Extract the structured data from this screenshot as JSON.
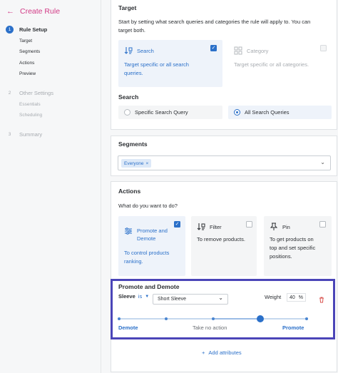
{
  "sidebar": {
    "back_title": "Create Rule",
    "steps": [
      {
        "num": "1",
        "label": "Rule Setup",
        "subs": [
          "Target",
          "Segments",
          "Actions",
          "Preview"
        ]
      },
      {
        "num": "2",
        "label": "Other Settings",
        "subs": [
          "Essentials",
          "Scheduling"
        ]
      },
      {
        "num": "3",
        "label": "Summary",
        "subs": []
      }
    ]
  },
  "target": {
    "title": "Target",
    "description_line1": "Start by setting what search queries and categories the rule will apply to. You can",
    "description_line2": "target both.",
    "options": [
      {
        "label": "Search",
        "desc_line1": "Target specific or all search",
        "desc_line2": "queries.",
        "checked": true,
        "icon": "search-sort-icon"
      },
      {
        "label": "Category",
        "desc_line1": "Target specific or all categories.",
        "desc_line2": "",
        "checked": false,
        "icon": "category-grid-icon"
      }
    ]
  },
  "search": {
    "title": "Search",
    "options": [
      {
        "label": "Specific Search Query",
        "selected": false
      },
      {
        "label": "All Search Queries",
        "selected": true
      }
    ]
  },
  "segments": {
    "title": "Segments",
    "chips": [
      "Everyone"
    ],
    "chip_remove": "×"
  },
  "actions": {
    "title": "Actions",
    "question": "What do you want to do?",
    "options": [
      {
        "label_line1": "Promote and",
        "label_line2": "Demote",
        "desc_line1": "To control products",
        "desc_line2": "ranking.",
        "desc_line3": "",
        "checked": true,
        "icon": "sliders-icon"
      },
      {
        "label_line1": "Filter",
        "label_line2": "",
        "desc_line1": "To remove products.",
        "desc_line2": "",
        "desc_line3": "",
        "checked": false,
        "icon": "filter-sort-icon"
      },
      {
        "label_line1": "Pin",
        "label_line2": "",
        "desc_line1": "To get products on",
        "desc_line2": "top and set specific",
        "desc_line3": "positions.",
        "checked": false,
        "icon": "pin-icon"
      }
    ]
  },
  "promote": {
    "title": "Promote and Demote",
    "attribute": "Sleeve",
    "operator": "is",
    "value": "Short Sleeve",
    "weight_label": "Weight",
    "weight_value": "40",
    "weight_unit": "%",
    "slider_left": "Demote",
    "slider_mid": "Take no action",
    "slider_right": "Promote",
    "slider_level": 0.75,
    "add_label": "Add attributes",
    "add_plus": "+"
  },
  "colors": {
    "accent": "#2b70c9",
    "brand": "#d23a86",
    "highlight": "#4b45b8",
    "danger": "#d9534f"
  }
}
